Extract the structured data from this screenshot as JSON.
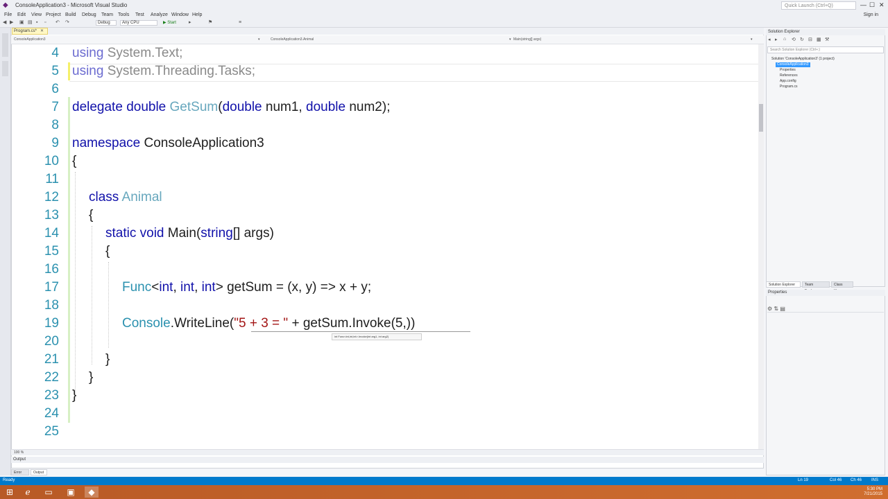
{
  "window": {
    "title": "ConsoleApplication3 - Microsoft Visual Studio",
    "quick_launch_placeholder": "Quick Launch (Ctrl+Q)",
    "sign_in": "Sign in",
    "min": "—",
    "max": "☐",
    "close": "✕"
  },
  "menu": [
    "File",
    "Edit",
    "View",
    "Project",
    "Build",
    "Debug",
    "Team",
    "Tools",
    "Test",
    "Analyze",
    "Window",
    "Help"
  ],
  "toolbar": {
    "config": "Debug",
    "platform": "Any CPU",
    "start": "▶ Start"
  },
  "editor": {
    "tab_label": "Program.cs*",
    "nav_project": "ConsoleApplication3",
    "nav_class": "ConsoleApplication3.Animal",
    "nav_member": "Main(string[] args)",
    "zoom": "100 %",
    "tooltip": "int Func<int,int,int>.Invoke(int arg1, int arg2)",
    "line_numbers": [
      "4",
      "5",
      "6",
      "7",
      "8",
      "9",
      "10",
      "11",
      "12",
      "13",
      "14",
      "15",
      "16",
      "17",
      "18",
      "19",
      "20",
      "21",
      "22",
      "23",
      "24",
      "25"
    ],
    "lines": {
      "l4_kw": "using",
      "l4_rest": " System.Text;",
      "l5_kw": "using",
      "l5_rest": " System.Threading.Tasks;",
      "l7_kw1": "delegate",
      "l7_sp1": " ",
      "l7_kw2": "double",
      "l7_sp2": " ",
      "l7_type": "GetSum",
      "l7_p1": "(",
      "l7_kw3": "double",
      "l7_p2": " num1, ",
      "l7_kw4": "double",
      "l7_p3": " num2);",
      "l9_kw": "namespace",
      "l9_rest": " ConsoleApplication3",
      "l10": "{",
      "l12_kw": "class",
      "l12_sp": " ",
      "l12_type": "Animal",
      "l13": "{",
      "l14_kw1": "static",
      "l14_sp1": " ",
      "l14_kw2": "void",
      "l14_p1": " Main(",
      "l14_kw3": "string",
      "l14_p2": "[] args)",
      "l15": "{",
      "l17_type": "Func",
      "l17_p1": "<",
      "l17_kw1": "int",
      "l17_p2": ", ",
      "l17_kw2": "int",
      "l17_p3": ", ",
      "l17_kw3": "int",
      "l17_p4": "> getSum = (x, y) => x + y;",
      "l19_type": "Console",
      "l19_p1": ".WriteLine(",
      "l19_str": "\"5 + 3 = \"",
      "l19_p2": " + getSum.Invoke(5,))",
      "l21": "}",
      "l22": "}",
      "l23": "}"
    }
  },
  "output": {
    "title": "Output",
    "tabs": [
      "Error List",
      "Output"
    ]
  },
  "solution_explorer": {
    "title": "Solution Explorer",
    "search_placeholder": "Search Solution Explorer (Ctrl+;)",
    "tree": [
      "Solution 'ConsoleApplication3' (1 project)",
      "ConsoleApplication3",
      "Properties",
      "References",
      "App.config",
      "Program.cs"
    ],
    "tabs": [
      "Solution Explorer",
      "Team Explorer",
      "Class View"
    ]
  },
  "properties": {
    "title": "Properties"
  },
  "status": {
    "left": "Ready",
    "ln": "Ln 19",
    "col": "Col 46",
    "ch": "Ch 46",
    "mode": "INS"
  },
  "taskbar": {
    "time": "5:30 PM",
    "date": "7/21/2015"
  }
}
